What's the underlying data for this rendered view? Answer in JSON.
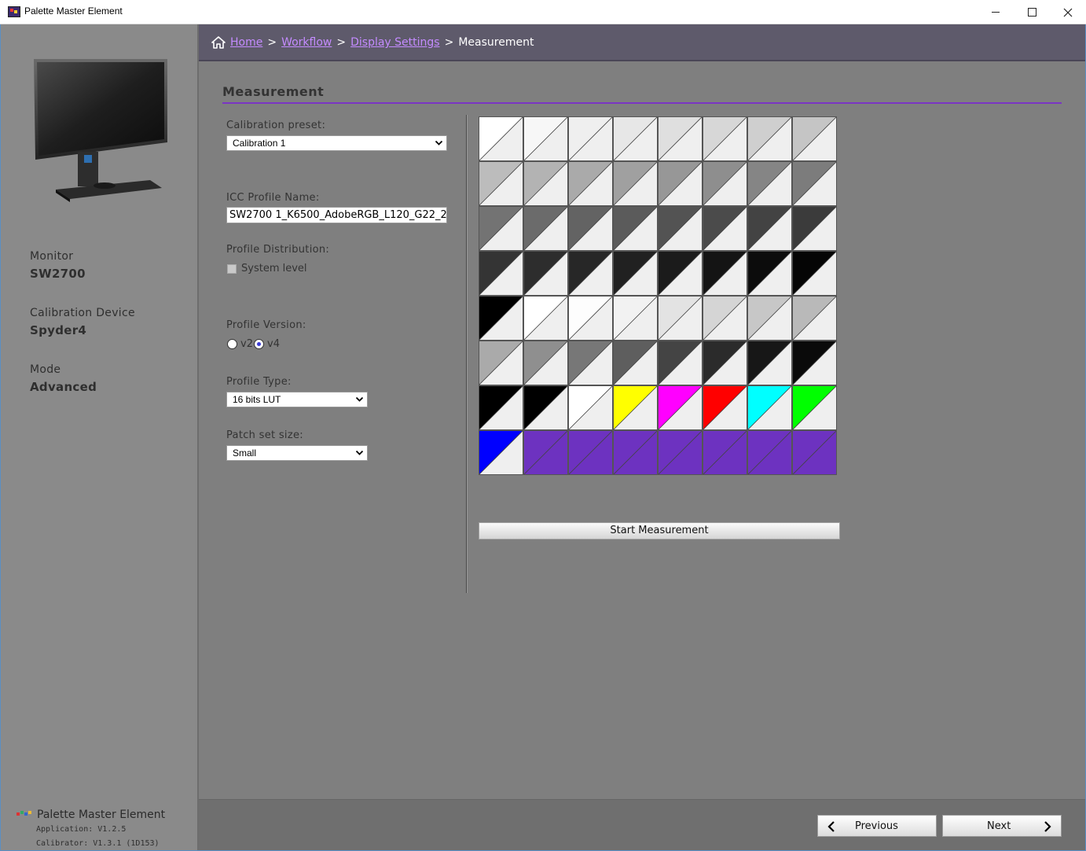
{
  "window": {
    "title": "Palette Master Element"
  },
  "sidebar": {
    "monitor_label": "Monitor",
    "monitor_value": "SW2700",
    "device_label": "Calibration Device",
    "device_value": "Spyder4",
    "mode_label": "Mode",
    "mode_value": "Advanced",
    "brand_name": "Palette Master Element",
    "app_version": "Application: V1.2.5",
    "calibrator_version": "Calibrator: V1.3.1 (1D153)"
  },
  "breadcrumb": {
    "items": [
      "Home",
      "Workflow",
      "Display Settings"
    ],
    "separator": ">",
    "current": "Measurement"
  },
  "page": {
    "title": "Measurement"
  },
  "form": {
    "preset_label": "Calibration preset:",
    "preset_value": "Calibration 1",
    "icc_label": "ICC Profile Name:",
    "icc_value": "SW2700 1_K6500_AdobeRGB_L120_G22_2",
    "distribution_label": "Profile Distribution:",
    "system_level_label": "System level",
    "version_label": "Profile Version:",
    "version_options": [
      "v2",
      "v4"
    ],
    "version_selected": "v4",
    "type_label": "Profile Type:",
    "type_value": "16 bits LUT",
    "patch_label": "Patch set size:",
    "patch_value": "Small"
  },
  "patches": {
    "colors": [
      "#ffffff",
      "#f7f7f7",
      "#efefef",
      "#e7e7e7",
      "#dfdfdf",
      "#d7d7d7",
      "#cfcfcf",
      "#c5c5c5",
      "#bcbcbc",
      "#b3b3b3",
      "#aaaaaa",
      "#a0a0a0",
      "#979797",
      "#8e8e8e",
      "#858585",
      "#7c7c7c",
      "#737373",
      "#6b6b6b",
      "#636363",
      "#5b5b5b",
      "#535353",
      "#4b4b4b",
      "#434343",
      "#3b3b3b",
      "#343434",
      "#2d2d2d",
      "#272727",
      "#212121",
      "#1b1b1b",
      "#141414",
      "#0c0c0c",
      "#050505",
      "#000000",
      "#ffffff",
      "#fdfdfd",
      "#f2f2f2",
      "#e3e3e3",
      "#d5d5d5",
      "#c7c7c7",
      "#b9b9b9",
      "#aaaaaa",
      "#8f8f8f",
      "#777777",
      "#5e5e5e",
      "#444444",
      "#2b2b2b",
      "#171717",
      "#0a0a0a",
      "#000000",
      "#000000",
      "#ffffff",
      "#ffff00",
      "#ff00ff",
      "#ff0000",
      "#00ffff",
      "#00ff00",
      "#0000ff",
      "#6d32c0",
      "#6d32c0",
      "#6d32c0",
      "#6d32c0",
      "#6d32c0",
      "#6d32c0",
      "#6d32c0"
    ],
    "reference_color": "#efefef",
    "empty_color": "#6d32c0",
    "columns": 8
  },
  "actions": {
    "start_label": "Start Measurement",
    "previous_label": "Previous",
    "next_label": "Next"
  }
}
